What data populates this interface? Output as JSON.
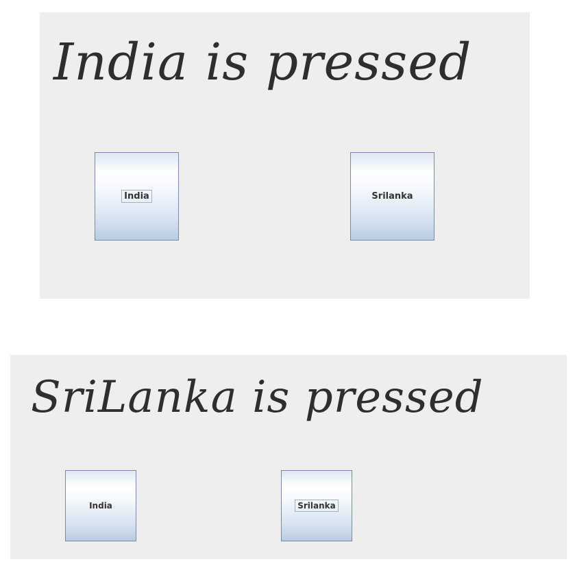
{
  "frames": [
    {
      "status_text": "India is pressed",
      "buttons": {
        "india": "India",
        "srilanka": "Srilanka"
      },
      "focused_button": "India"
    },
    {
      "status_text": "SriLanka is pressed",
      "buttons": {
        "india": "India",
        "srilanka": "Srilanka"
      },
      "focused_button": "Srilanka"
    }
  ],
  "colors": {
    "panel_background": "#eeeeee",
    "text": "#2e2e2e",
    "button_border": "#7a8aa3"
  }
}
